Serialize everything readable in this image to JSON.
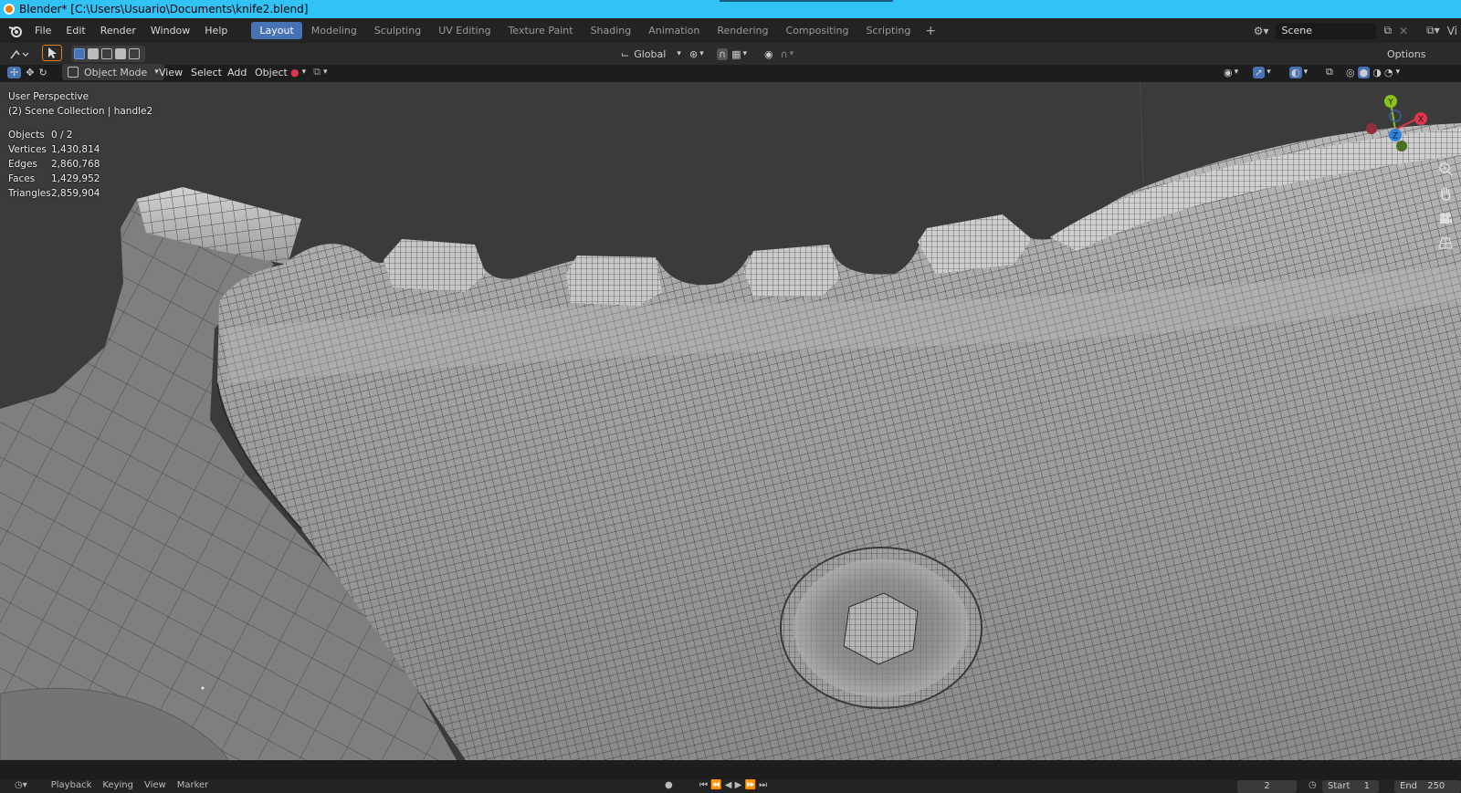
{
  "window": {
    "title": "Blender* [C:\\Users\\Usuario\\Documents\\knife2.blend]"
  },
  "menu": [
    "File",
    "Edit",
    "Render",
    "Window",
    "Help"
  ],
  "workspace_tabs": [
    {
      "label": "Layout",
      "active": true
    },
    {
      "label": "Modeling",
      "active": false
    },
    {
      "label": "Sculpting",
      "active": false
    },
    {
      "label": "UV Editing",
      "active": false
    },
    {
      "label": "Texture Paint",
      "active": false
    },
    {
      "label": "Shading",
      "active": false
    },
    {
      "label": "Animation",
      "active": false
    },
    {
      "label": "Rendering",
      "active": false
    },
    {
      "label": "Compositing",
      "active": false
    },
    {
      "label": "Scripting",
      "active": false
    }
  ],
  "workspace_add": "+",
  "scene": {
    "label": "Scene",
    "partial_right": "Vi"
  },
  "tool_header": {
    "transform_orientation": "Global",
    "options_label": "Options"
  },
  "view_header": {
    "mode": "Object Mode",
    "menus": [
      "View",
      "Select",
      "Add",
      "Object"
    ]
  },
  "viewport_info": {
    "perspective": "User Perspective",
    "collection": "(2) Scene Collection | handle2",
    "stats": [
      {
        "label": "Objects",
        "value": "0 / 2"
      },
      {
        "label": "Vertices",
        "value": "1,430,814"
      },
      {
        "label": "Edges",
        "value": "2,860,768"
      },
      {
        "label": "Faces",
        "value": "1,429,952"
      },
      {
        "label": "Triangles",
        "value": "2,859,904"
      }
    ]
  },
  "gizmo": {
    "axes": [
      "Y",
      "X",
      "Z"
    ],
    "colors": {
      "x": "#e0344b",
      "y": "#88c21c",
      "z": "#2f83e0"
    }
  },
  "timeline": {
    "menus": [
      "Playback",
      "Keying",
      "View",
      "Marker"
    ],
    "current_frame": "2",
    "start_label": "Start",
    "start_value": "1",
    "end_label": "End",
    "end_value": "250"
  },
  "colors": {
    "titlebar": "#31c2f6",
    "active_tab": "#4772b3",
    "viewport_bg": "#3a3a3a"
  }
}
